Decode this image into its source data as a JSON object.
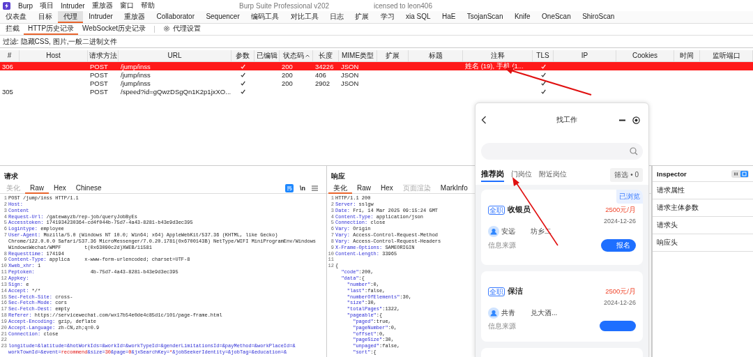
{
  "title_bar": {
    "menus": [
      "Burp",
      "项目",
      "Intruder",
      "重放器",
      "窗口",
      "帮助"
    ],
    "title_start": "Burp Suite Professional v202",
    "title_end": "icensed to leon406"
  },
  "main_tabs": [
    {
      "label": "仪表盘",
      "selected": false
    },
    {
      "label": "目标",
      "selected": false
    },
    {
      "label": "代理",
      "selected": true
    },
    {
      "label": "Intruder",
      "selected": false
    },
    {
      "label": "重放器",
      "selected": false
    },
    {
      "label": "Collaborator",
      "selected": false
    },
    {
      "label": "Sequencer",
      "selected": false
    },
    {
      "label": "编码工具",
      "selected": false
    },
    {
      "label": "对比工具",
      "selected": false
    },
    {
      "label": "日志",
      "selected": false
    },
    {
      "label": "扩展",
      "selected": false
    },
    {
      "label": "学习",
      "selected": false
    },
    {
      "label": "xia SQL",
      "selected": false
    },
    {
      "label": "HaE",
      "selected": false
    },
    {
      "label": "TsojanScan",
      "selected": false
    },
    {
      "label": "Knife",
      "selected": false
    },
    {
      "label": "OneScan",
      "selected": false
    },
    {
      "label": "ShiroScan",
      "selected": false
    }
  ],
  "sub_tabs": [
    {
      "kind": "tab",
      "label": "拦截",
      "selected": false
    },
    {
      "kind": "tab",
      "label": "HTTP历史记录",
      "selected": true
    },
    {
      "kind": "tab",
      "label": "WebSocket历史记录",
      "selected": false
    },
    {
      "kind": "settings",
      "label": "代理设置",
      "selected": false
    }
  ],
  "filter": "过滤: 隐藏CSS, 图片,一般二进制文件",
  "table": {
    "columns": [
      "#",
      "Host",
      "请求方法",
      "URL",
      "参数",
      "已编辑",
      "状态码",
      "长度",
      "MIME类型",
      "扩展",
      "标题",
      "注释",
      "TLS",
      "IP",
      "Cookies",
      "时间",
      "监听端口"
    ],
    "rows": [
      {
        "num": "306",
        "method": "POST",
        "url": "/jump/inss",
        "params": true,
        "status": "200",
        "length": "34226",
        "mime": "JSON",
        "note": "姓名 (19), 手机 (1...",
        "tls": true,
        "selected": true
      },
      {
        "method": "POST",
        "url": "/jump/inss",
        "params": true,
        "status": "200",
        "length": "406",
        "mime": "JSON",
        "tls": true,
        "selected": false
      },
      {
        "method": "POST",
        "url": "/jump/inss",
        "params": true,
        "status": "200",
        "length": "2902",
        "mime": "JSON",
        "tls": true,
        "selected": false
      },
      {
        "num": "305",
        "method": "POST",
        "url": "/speed?id=gQwzDSgQn1K2p1jxXO...",
        "params": true,
        "tls": true,
        "selected": false
      }
    ]
  },
  "request": {
    "title": "请求",
    "tabs": [
      {
        "label": "美化",
        "selected": false,
        "disabled": true
      },
      {
        "label": "Raw",
        "selected": true,
        "disabled": false
      },
      {
        "label": "Hex",
        "selected": false,
        "disabled": false
      },
      {
        "label": "Chinese",
        "selected": false,
        "disabled": false
      }
    ],
    "tools": [
      {
        "kind": "wrap",
        "selected": true
      },
      {
        "kind": "newline",
        "label": "\\n",
        "selected": false
      },
      {
        "kind": "menu",
        "selected": false
      }
    ],
    "lines": [
      {
        "num": "1",
        "segments": [
          {
            "kind": "plain",
            "text": "POST /jump/inss HTTP/1.1"
          }
        ]
      },
      {
        "num": "2",
        "segments": [
          {
            "kind": "key",
            "text": "Host:"
          }
        ]
      },
      {
        "num": "3",
        "segments": [
          {
            "kind": "key",
            "text": "Content"
          }
        ]
      },
      {
        "num": "4",
        "segments": [
          {
            "kind": "key",
            "text": "Request-Url:"
          },
          {
            "kind": "plain",
            "text": " /gatewayzb/rep-job/queryJobByEs"
          }
        ]
      },
      {
        "num": "5",
        "segments": [
          {
            "kind": "key",
            "text": "Accesstoken:"
          },
          {
            "kind": "plain",
            "text": " 1741934230364-cd4f044b-75d7-4a43-8281-b43e9d3ec395"
          }
        ]
      },
      {
        "num": "6",
        "segments": [
          {
            "kind": "key",
            "text": "Logintype:"
          },
          {
            "kind": "plain",
            "text": " employee"
          }
        ]
      },
      {
        "num": "7",
        "segments": [
          {
            "kind": "key",
            "text": "User-Agent:"
          },
          {
            "kind": "plain",
            "text": " Mozilla/5.0 (Windows NT 10.0; Win64; x64) AppleWebKit/537.36 (KHTML, like Gecko)"
          }
        ]
      },
      {
        "segments": [
          {
            "kind": "plain",
            "text": "Chrome/122.0.0.0 Safari/537.36 MicroMessenger/7.0.20.1781(0x6700143B) NetType/WIFI MiniProgramEnv/Windows"
          }
        ]
      },
      {
        "segments": [
          {
            "kind": "plain",
            "text": "WindowsWechat/WMPF        t(0x63090c2d)XWEB/11581"
          }
        ]
      },
      {
        "num": "8",
        "segments": [
          {
            "kind": "key",
            "text": "Requesttime:"
          },
          {
            "kind": "plain",
            "text": " 174194"
          }
        ]
      },
      {
        "num": "9",
        "segments": [
          {
            "kind": "key",
            "text": "Content-Type:"
          },
          {
            "kind": "plain",
            "text": " applica     x-www-form-urlencoded; charset=UTF-8"
          }
        ]
      },
      {
        "num": "10",
        "segments": [
          {
            "kind": "key",
            "text": "Xweb_xhr:"
          },
          {
            "kind": "plain",
            "text": " 1"
          }
        ]
      },
      {
        "num": "11",
        "segments": [
          {
            "kind": "key",
            "text": "Peptoken:"
          },
          {
            "kind": "plain",
            "text": "                   4b-75d7-4a43-8281-b43e9d3ec395"
          }
        ]
      },
      {
        "num": "12",
        "segments": [
          {
            "kind": "key",
            "text": "Appkey:"
          }
        ]
      },
      {
        "num": "13",
        "segments": [
          {
            "kind": "key",
            "text": "Sign:"
          },
          {
            "kind": "plain",
            "text": " e"
          }
        ]
      },
      {
        "num": "14",
        "segments": [
          {
            "kind": "key",
            "text": "Accept:"
          },
          {
            "kind": "plain",
            "text": " */*"
          }
        ]
      },
      {
        "num": "15",
        "segments": [
          {
            "kind": "key",
            "text": "Sec-Fetch-Site:"
          },
          {
            "kind": "plain",
            "text": " cross-"
          }
        ]
      },
      {
        "num": "16",
        "segments": [
          {
            "kind": "key",
            "text": "Sec-Fetch-Mode:"
          },
          {
            "kind": "plain",
            "text": " cors"
          }
        ]
      },
      {
        "num": "17",
        "segments": [
          {
            "kind": "key",
            "text": "Sec-Fetch-Dest:"
          },
          {
            "kind": "plain",
            "text": " empty"
          }
        ]
      },
      {
        "num": "18",
        "segments": [
          {
            "kind": "key",
            "text": "Referer:"
          },
          {
            "kind": "plain",
            "text": " https://servicewechat.com/wx17b54e0de4c85d1c/101/page-frame.html"
          }
        ]
      },
      {
        "num": "19",
        "segments": [
          {
            "kind": "key",
            "text": "Accept-Encoding:"
          },
          {
            "kind": "plain",
            "text": " gzip, deflate"
          }
        ]
      },
      {
        "num": "20",
        "segments": [
          {
            "kind": "key",
            "text": "Accept-Language:"
          },
          {
            "kind": "plain",
            "text": " zh-CN,zh;q=0.9"
          }
        ]
      },
      {
        "num": "21",
        "segments": [
          {
            "kind": "key",
            "text": "Connection:"
          },
          {
            "kind": "plain",
            "text": " close"
          }
        ]
      },
      {
        "num": "22"
      },
      {
        "num": "23",
        "segments": [
          {
            "kind": "key",
            "text": "longitude=&latitude=&hotWorkIds=&workId=&workTypeId=&genderLimitationsId=&payMethod=&workPlaceId=&"
          }
        ]
      },
      {
        "segments": [
          {
            "kind": "key",
            "text": "workTownId=&event="
          },
          {
            "kind": "value",
            "text": "recommend"
          },
          {
            "kind": "key",
            "text": "&size="
          },
          {
            "kind": "value",
            "text": "30"
          },
          {
            "kind": "key",
            "text": "&page="
          },
          {
            "kind": "value",
            "text": "0"
          },
          {
            "kind": "key",
            "text": "&jxSearchKey="
          },
          {
            "kind": "value",
            "text": "*"
          },
          {
            "kind": "key",
            "text": "&jobSeekerIdentity=&jobTag=&education=&"
          }
        ]
      }
    ]
  },
  "response": {
    "title": "响应",
    "tabs": [
      {
        "label": "美化",
        "selected": true,
        "disabled": false
      },
      {
        "label": "Raw",
        "selected": false,
        "disabled": false
      },
      {
        "label": "Hex",
        "selected": false,
        "disabled": false
      },
      {
        "label": "页面渲染",
        "selected": false,
        "disabled": true
      },
      {
        "label": "MarkInfo",
        "selected": false,
        "disabled": false
      }
    ],
    "lines": [
      {
        "num": "1",
        "segments": [
          {
            "kind": "plain",
            "text": "HTTP/1.1 200"
          }
        ]
      },
      {
        "num": "2",
        "segments": [
          {
            "kind": "key",
            "text": "Server:"
          },
          {
            "kind": "plain",
            "text": " sslgw"
          }
        ]
      },
      {
        "num": "3",
        "segments": [
          {
            "kind": "key",
            "text": "Date:"
          },
          {
            "kind": "plain",
            "text": " Fri, 14 Mar 2025 09:15:24 GMT"
          }
        ]
      },
      {
        "num": "4",
        "segments": [
          {
            "kind": "key",
            "text": "Content-Type:"
          },
          {
            "kind": "plain",
            "text": " application/json"
          }
        ]
      },
      {
        "num": "5",
        "segments": [
          {
            "kind": "key",
            "text": "Connection:"
          },
          {
            "kind": "plain",
            "text": " close"
          }
        ]
      },
      {
        "num": "6",
        "segments": [
          {
            "kind": "key",
            "text": "Vary:"
          },
          {
            "kind": "plain",
            "text": " Origin"
          }
        ]
      },
      {
        "num": "7",
        "segments": [
          {
            "kind": "key",
            "text": "Vary:"
          },
          {
            "kind": "plain",
            "text": " Access-Control-Request-Method"
          }
        ]
      },
      {
        "num": "8",
        "segments": [
          {
            "kind": "key",
            "text": "Vary:"
          },
          {
            "kind": "plain",
            "text": " Access-Control-Request-Headers"
          }
        ]
      },
      {
        "num": "9",
        "segments": [
          {
            "kind": "key",
            "text": "X-Frame-Options:"
          },
          {
            "kind": "plain",
            "text": " SAMEORIGIN"
          }
        ]
      },
      {
        "num": "10",
        "segments": [
          {
            "kind": "key",
            "text": "Content-Length:"
          },
          {
            "kind": "plain",
            "text": " 33965"
          }
        ]
      },
      {
        "num": "11"
      },
      {
        "num": "12",
        "segments": [
          {
            "kind": "plain",
            "text": "{"
          }
        ]
      },
      {
        "segments": [
          {
            "kind": "key",
            "text": "  \"code\""
          },
          {
            "kind": "plain",
            "text": ":200,"
          }
        ]
      },
      {
        "segments": [
          {
            "kind": "key",
            "text": "  \"data\""
          },
          {
            "kind": "plain",
            "text": ":{"
          }
        ]
      },
      {
        "segments": [
          {
            "kind": "key",
            "text": "    \"number\""
          },
          {
            "kind": "plain",
            "text": ":0,"
          }
        ]
      },
      {
        "segments": [
          {
            "kind": "key",
            "text": "    \"last\""
          },
          {
            "kind": "plain",
            "text": ":false,"
          }
        ]
      },
      {
        "segments": [
          {
            "kind": "key",
            "text": "    \"numberOfElements\""
          },
          {
            "kind": "plain",
            "text": ":30,"
          }
        ]
      },
      {
        "segments": [
          {
            "kind": "key",
            "text": "    \"size\""
          },
          {
            "kind": "plain",
            "text": ":30,"
          }
        ]
      },
      {
        "segments": [
          {
            "kind": "key",
            "text": "    \"totalPages\""
          },
          {
            "kind": "plain",
            "text": ":1322,"
          }
        ]
      },
      {
        "segments": [
          {
            "kind": "key",
            "text": "    \"pageable\""
          },
          {
            "kind": "plain",
            "text": ":{"
          }
        ]
      },
      {
        "segments": [
          {
            "kind": "key",
            "text": "      \"paged\""
          },
          {
            "kind": "plain",
            "text": ":true,"
          }
        ]
      },
      {
        "segments": [
          {
            "kind": "key",
            "text": "      \"pageNumber\""
          },
          {
            "kind": "plain",
            "text": ":0,"
          }
        ]
      },
      {
        "segments": [
          {
            "kind": "key",
            "text": "      \"offset\""
          },
          {
            "kind": "plain",
            "text": ":0,"
          }
        ]
      },
      {
        "segments": [
          {
            "kind": "key",
            "text": "      \"pageSize\""
          },
          {
            "kind": "plain",
            "text": ":30,"
          }
        ]
      },
      {
        "segments": [
          {
            "kind": "key",
            "text": "      \"unpaged\""
          },
          {
            "kind": "plain",
            "text": ":false,"
          }
        ]
      },
      {
        "segments": [
          {
            "kind": "key",
            "text": "      \"sort\""
          },
          {
            "kind": "plain",
            "text": ":{"
          }
        ]
      }
    ]
  },
  "inspector": {
    "title": "Inspector",
    "views": [
      {
        "kind": "list",
        "selected": false
      },
      {
        "kind": "panel",
        "selected": true
      }
    ],
    "sections": [
      "请求属性",
      "请求主体参数",
      "请求头",
      "响应头"
    ]
  },
  "mini_app": {
    "title": "找工作",
    "tabs": [
      {
        "label": "推荐岗",
        "selected": true
      },
      {
        "label": "门岗位",
        "selected": false
      },
      {
        "label": "附近岗位",
        "selected": false
      }
    ],
    "filter": "筛选 • 0",
    "jobs": [
      {
        "badge": "已浏览",
        "type": "全职",
        "title": "收银员",
        "salary": "2500元/月",
        "date": "2024-12-26",
        "company_start": "安远",
        "company_end": "坊乡二",
        "source_label": "信息来源",
        "apply": "报名"
      },
      {
        "type": "全职",
        "title": "保洁",
        "salary": "2500元/月",
        "date": "2024-12-26",
        "company_start": "共青",
        "company_end": "兑大酒...",
        "source_label": "信息来源"
      }
    ]
  }
}
